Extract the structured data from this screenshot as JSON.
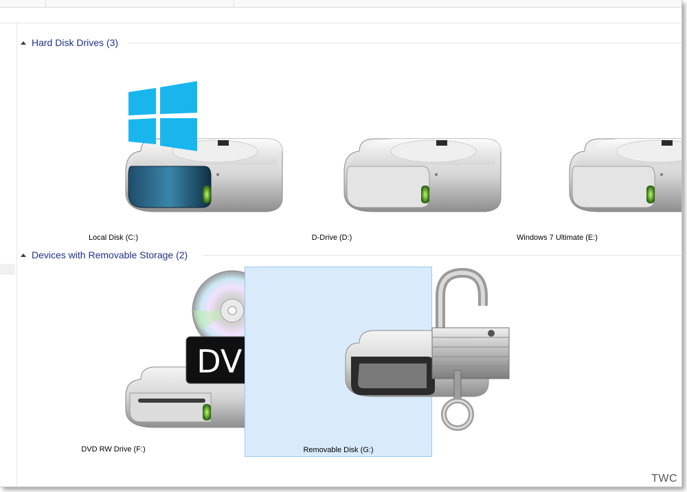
{
  "groups": {
    "hard_disk": {
      "label": "Hard Disk Drives (3)"
    },
    "removable": {
      "label": "Devices with Removable Storage (2)"
    }
  },
  "drives": {
    "c": {
      "name": "Local Disk (C:)",
      "icon": "windows-hard-disk-icon"
    },
    "d": {
      "name": "D-Drive (D:)",
      "icon": "hard-disk-icon"
    },
    "e": {
      "name": "Windows 7 Ultimate (E:)",
      "icon": "hard-disk-icon"
    },
    "f": {
      "name": "DVD RW Drive (F:)",
      "icon": "dvd-drive-icon",
      "badge": "DVD"
    },
    "g": {
      "name": "Removable Disk (G:)",
      "icon": "locked-removable-disk-icon",
      "selected": true
    }
  },
  "watermark": "TWC",
  "colors": {
    "header_text": "#1e3287",
    "selection_fill": "#d9ebfb",
    "selection_border": "#99c9ef",
    "windows_logo": "#19b6ee"
  }
}
